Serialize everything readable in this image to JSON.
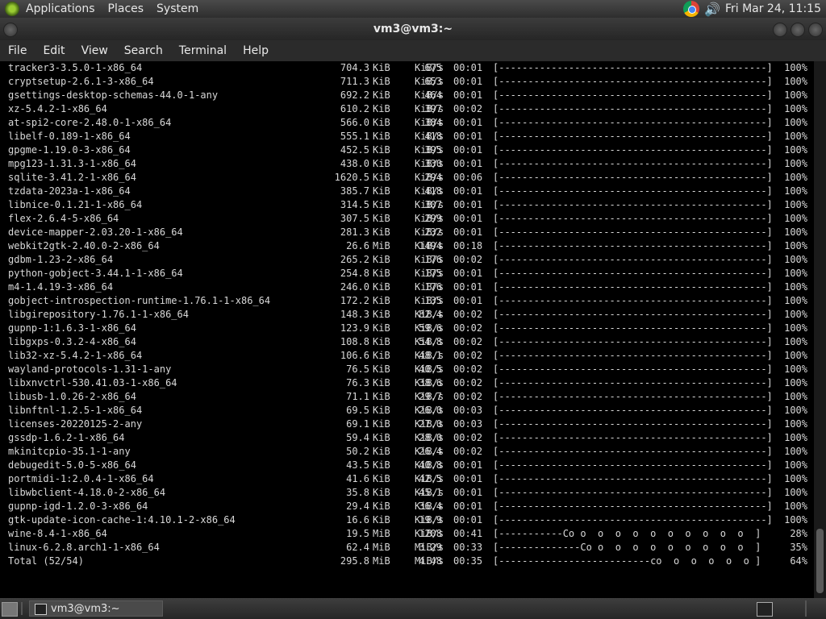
{
  "top_panel": {
    "menus": [
      "Applications",
      "Places",
      "System"
    ],
    "clock": "Fri Mar 24, 11:15"
  },
  "window": {
    "title": "vm3@vm3:~"
  },
  "menubar": [
    "File",
    "Edit",
    "View",
    "Search",
    "Terminal",
    "Help"
  ],
  "rows": [
    {
      "name": "tracker3-3.5.0-1-x86_64",
      "size": "704.3",
      "unit": "KiB",
      "rate": "675",
      "runit": "KiB/s",
      "time": "00:01",
      "bar": "[----------------------------------------------]",
      "pct": "100%"
    },
    {
      "name": "cryptsetup-2.6.1-3-x86_64",
      "size": "711.3",
      "unit": "KiB",
      "rate": "653",
      "runit": "KiB/s",
      "time": "00:01",
      "bar": "[----------------------------------------------]",
      "pct": "100%"
    },
    {
      "name": "gsettings-desktop-schemas-44.0-1-any",
      "size": "692.2",
      "unit": "KiB",
      "rate": "464",
      "runit": "KiB/s",
      "time": "00:01",
      "bar": "[----------------------------------------------]",
      "pct": "100%"
    },
    {
      "name": "xz-5.4.2-1-x86_64",
      "size": "610.2",
      "unit": "KiB",
      "rate": "397",
      "runit": "KiB/s",
      "time": "00:02",
      "bar": "[----------------------------------------------]",
      "pct": "100%"
    },
    {
      "name": "at-spi2-core-2.48.0-1-x86_64",
      "size": "566.0",
      "unit": "KiB",
      "rate": "384",
      "runit": "KiB/s",
      "time": "00:01",
      "bar": "[----------------------------------------------]",
      "pct": "100%"
    },
    {
      "name": "libelf-0.189-1-x86_64",
      "size": "555.1",
      "unit": "KiB",
      "rate": "418",
      "runit": "KiB/s",
      "time": "00:01",
      "bar": "[----------------------------------------------]",
      "pct": "100%"
    },
    {
      "name": "gpgme-1.19.0-3-x86_64",
      "size": "452.5",
      "unit": "KiB",
      "rate": "395",
      "runit": "KiB/s",
      "time": "00:01",
      "bar": "[----------------------------------------------]",
      "pct": "100%"
    },
    {
      "name": "mpg123-1.31.3-1-x86_64",
      "size": "438.0",
      "unit": "KiB",
      "rate": "330",
      "runit": "KiB/s",
      "time": "00:01",
      "bar": "[----------------------------------------------]",
      "pct": "100%"
    },
    {
      "name": "sqlite-3.41.2-1-x86_64",
      "size": "1620.5",
      "unit": "KiB",
      "rate": "294",
      "runit": "KiB/s",
      "time": "00:06",
      "bar": "[----------------------------------------------]",
      "pct": "100%"
    },
    {
      "name": "tzdata-2023a-1-x86_64",
      "size": "385.7",
      "unit": "KiB",
      "rate": "418",
      "runit": "KiB/s",
      "time": "00:01",
      "bar": "[----------------------------------------------]",
      "pct": "100%"
    },
    {
      "name": "libnice-0.1.21-1-x86_64",
      "size": "314.5",
      "unit": "KiB",
      "rate": "307",
      "runit": "KiB/s",
      "time": "00:01",
      "bar": "[----------------------------------------------]",
      "pct": "100%"
    },
    {
      "name": "flex-2.6.4-5-x86_64",
      "size": "307.5",
      "unit": "KiB",
      "rate": "299",
      "runit": "KiB/s",
      "time": "00:01",
      "bar": "[----------------------------------------------]",
      "pct": "100%"
    },
    {
      "name": "device-mapper-2.03.20-1-x86_64",
      "size": "281.3",
      "unit": "KiB",
      "rate": "232",
      "runit": "KiB/s",
      "time": "00:01",
      "bar": "[----------------------------------------------]",
      "pct": "100%"
    },
    {
      "name": "webkit2gtk-2.40.0-2-x86_64",
      "size": "26.6",
      "unit": "MiB",
      "rate": "1494",
      "runit": "KiB/s",
      "time": "00:18",
      "bar": "[----------------------------------------------]",
      "pct": "100%"
    },
    {
      "name": "gdbm-1.23-2-x86_64",
      "size": "265.2",
      "unit": "KiB",
      "rate": "176",
      "runit": "KiB/s",
      "time": "00:02",
      "bar": "[----------------------------------------------]",
      "pct": "100%"
    },
    {
      "name": "python-gobject-3.44.1-1-x86_64",
      "size": "254.8",
      "unit": "KiB",
      "rate": "175",
      "runit": "KiB/s",
      "time": "00:01",
      "bar": "[----------------------------------------------]",
      "pct": "100%"
    },
    {
      "name": "m4-1.4.19-3-x86_64",
      "size": "246.0",
      "unit": "KiB",
      "rate": "176",
      "runit": "KiB/s",
      "time": "00:01",
      "bar": "[----------------------------------------------]",
      "pct": "100%"
    },
    {
      "name": "gobject-introspection-runtime-1.76.1-1-x86_64",
      "size": "172.2",
      "unit": "KiB",
      "rate": "135",
      "runit": "KiB/s",
      "time": "00:01",
      "bar": "[----------------------------------------------]",
      "pct": "100%"
    },
    {
      "name": "libgirepository-1.76.1-1-x86_64",
      "size": "148.3",
      "unit": "KiB",
      "rate": "82.4",
      "runit": "KiB/s",
      "time": "00:02",
      "bar": "[----------------------------------------------]",
      "pct": "100%"
    },
    {
      "name": "gupnp-1:1.6.3-1-x86_64",
      "size": "123.9",
      "unit": "KiB",
      "rate": "59.6",
      "runit": "KiB/s",
      "time": "00:02",
      "bar": "[----------------------------------------------]",
      "pct": "100%"
    },
    {
      "name": "libgxps-0.3.2-4-x86_64",
      "size": "108.8",
      "unit": "KiB",
      "rate": "54.8",
      "runit": "KiB/s",
      "time": "00:02",
      "bar": "[----------------------------------------------]",
      "pct": "100%"
    },
    {
      "name": "lib32-xz-5.4.2-1-x86_64",
      "size": "106.6",
      "unit": "KiB",
      "rate": "48.1",
      "runit": "KiB/s",
      "time": "00:02",
      "bar": "[----------------------------------------------]",
      "pct": "100%"
    },
    {
      "name": "wayland-protocols-1.31-1-any",
      "size": "76.5",
      "unit": "KiB",
      "rate": "40.5",
      "runit": "KiB/s",
      "time": "00:02",
      "bar": "[----------------------------------------------]",
      "pct": "100%"
    },
    {
      "name": "libxnvctrl-530.41.03-1-x86_64",
      "size": "76.3",
      "unit": "KiB",
      "rate": "38.6",
      "runit": "KiB/s",
      "time": "00:02",
      "bar": "[----------------------------------------------]",
      "pct": "100%"
    },
    {
      "name": "libusb-1.0.26-2-x86_64",
      "size": "71.1",
      "unit": "KiB",
      "rate": "29.7",
      "runit": "KiB/s",
      "time": "00:02",
      "bar": "[----------------------------------------------]",
      "pct": "100%"
    },
    {
      "name": "libnftnl-1.2.5-1-x86_64",
      "size": "69.5",
      "unit": "KiB",
      "rate": "26.0",
      "runit": "KiB/s",
      "time": "00:03",
      "bar": "[----------------------------------------------]",
      "pct": "100%"
    },
    {
      "name": "licenses-20220125-2-any",
      "size": "69.1",
      "unit": "KiB",
      "rate": "27.0",
      "runit": "KiB/s",
      "time": "00:03",
      "bar": "[----------------------------------------------]",
      "pct": "100%"
    },
    {
      "name": "gssdp-1.6.2-1-x86_64",
      "size": "59.4",
      "unit": "KiB",
      "rate": "28.0",
      "runit": "KiB/s",
      "time": "00:02",
      "bar": "[----------------------------------------------]",
      "pct": "100%"
    },
    {
      "name": "mkinitcpio-35.1-1-any",
      "size": "50.2",
      "unit": "KiB",
      "rate": "26.4",
      "runit": "KiB/s",
      "time": "00:02",
      "bar": "[----------------------------------------------]",
      "pct": "100%"
    },
    {
      "name": "debugedit-5.0-5-x86_64",
      "size": "43.5",
      "unit": "KiB",
      "rate": "40.8",
      "runit": "KiB/s",
      "time": "00:01",
      "bar": "[----------------------------------------------]",
      "pct": "100%"
    },
    {
      "name": "portmidi-1:2.0.4-1-x86_64",
      "size": "41.6",
      "unit": "KiB",
      "rate": "42.5",
      "runit": "KiB/s",
      "time": "00:01",
      "bar": "[----------------------------------------------]",
      "pct": "100%"
    },
    {
      "name": "libwbclient-4.18.0-2-x86_64",
      "size": "35.8",
      "unit": "KiB",
      "rate": "45.1",
      "runit": "KiB/s",
      "time": "00:01",
      "bar": "[----------------------------------------------]",
      "pct": "100%"
    },
    {
      "name": "gupnp-igd-1.2.0-3-x86_64",
      "size": "29.4",
      "unit": "KiB",
      "rate": "36.4",
      "runit": "KiB/s",
      "time": "00:01",
      "bar": "[----------------------------------------------]",
      "pct": "100%"
    },
    {
      "name": "gtk-update-icon-cache-1:4.10.1-2-x86_64",
      "size": "16.6",
      "unit": "KiB",
      "rate": "19.9",
      "runit": "KiB/s",
      "time": "00:01",
      "bar": "[----------------------------------------------]",
      "pct": "100%"
    },
    {
      "name": "wine-8.4-1-x86_64",
      "size": "19.5",
      "unit": "MiB",
      "rate": "1208",
      "runit": "KiB/s",
      "time": "00:41",
      "bar": "[-----------Co o  o  o  o  o  o  o  o  o  o  ]",
      "pct": "28%"
    },
    {
      "name": "linux-6.2.8.arch1-1-x86_64",
      "size": "62.4",
      "unit": "MiB",
      "rate": "3.29",
      "runit": "MiB/s",
      "time": "00:33",
      "bar": "[--------------Co o  o  o  o  o  o  o  o  o  ]",
      "pct": "35%"
    },
    {
      "name": "Total (52/54)",
      "size": "295.8",
      "unit": "MiB",
      "rate": "4.48",
      "runit": "MiB/s",
      "time": "00:35",
      "bar": "[--------------------------co  o  o  o  o  o ]",
      "pct": "64%"
    }
  ],
  "taskbar": {
    "task_label": "vm3@vm3:~"
  }
}
